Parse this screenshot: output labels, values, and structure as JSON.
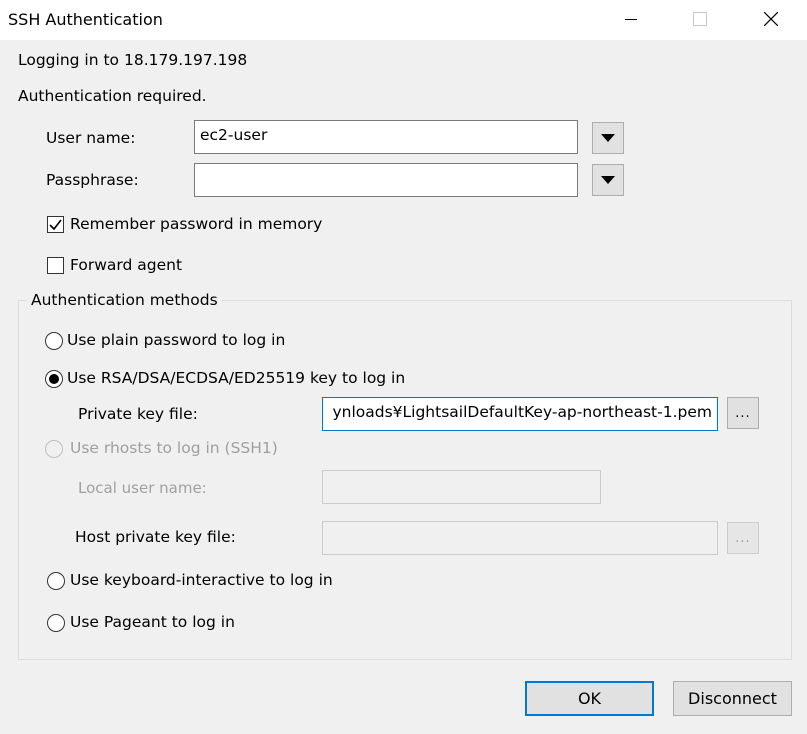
{
  "window": {
    "title": "SSH Authentication"
  },
  "header": {
    "logging_in": "Logging in to 18.179.197.198",
    "auth_required": "Authentication required."
  },
  "form": {
    "user_label": "User name:",
    "user_value": "ec2-user",
    "pass_label": "Passphrase:",
    "pass_value": "",
    "remember_label": "Remember password in memory",
    "remember_checked": true,
    "forward_label": "Forward agent",
    "forward_checked": false
  },
  "methods": {
    "group_label": "Authentication methods",
    "plain_label": "Use plain password to log in",
    "rsa_label": "Use RSA/DSA/ECDSA/ED25519 key to log in",
    "private_key_label": "Private key file:",
    "private_key_value": "ynloads¥LightsailDefaultKey-ap-northeast-1.pem",
    "browse_label": "...",
    "rhosts_label": "Use rhosts to log in (SSH1)",
    "local_user_label": "Local user name:",
    "host_key_label": "Host private key file:",
    "host_browse_label": "...",
    "keyboard_label": "Use keyboard-interactive to log in",
    "pageant_label": "Use Pageant to log in",
    "selected": "rsa"
  },
  "buttons": {
    "ok": "OK",
    "disconnect": "Disconnect"
  },
  "icons": {
    "minimize": "minimize-icon",
    "maximize": "maximize-icon",
    "close": "close-icon",
    "dropdown": "chevron-down-icon"
  },
  "colors": {
    "accent": "#0078d7",
    "dialog_bg": "#f0f0f0",
    "disabled_text": "#a0a0a0"
  }
}
